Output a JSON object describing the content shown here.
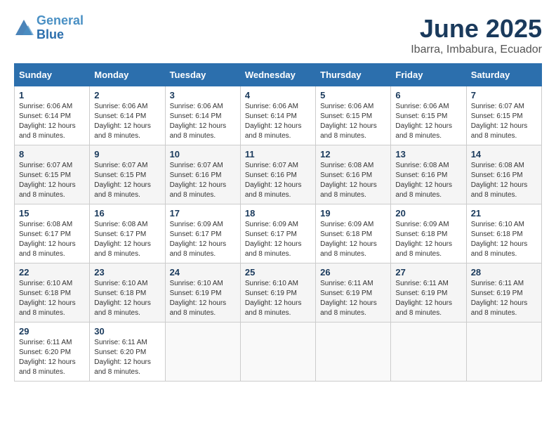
{
  "header": {
    "logo_line1": "General",
    "logo_line2": "Blue",
    "month": "June 2025",
    "location": "Ibarra, Imbabura, Ecuador"
  },
  "days_of_week": [
    "Sunday",
    "Monday",
    "Tuesday",
    "Wednesday",
    "Thursday",
    "Friday",
    "Saturday"
  ],
  "weeks": [
    [
      {
        "day": "1",
        "sunrise": "6:06 AM",
        "sunset": "6:14 PM",
        "daylight": "12 hours and 8 minutes."
      },
      {
        "day": "2",
        "sunrise": "6:06 AM",
        "sunset": "6:14 PM",
        "daylight": "12 hours and 8 minutes."
      },
      {
        "day": "3",
        "sunrise": "6:06 AM",
        "sunset": "6:14 PM",
        "daylight": "12 hours and 8 minutes."
      },
      {
        "day": "4",
        "sunrise": "6:06 AM",
        "sunset": "6:14 PM",
        "daylight": "12 hours and 8 minutes."
      },
      {
        "day": "5",
        "sunrise": "6:06 AM",
        "sunset": "6:15 PM",
        "daylight": "12 hours and 8 minutes."
      },
      {
        "day": "6",
        "sunrise": "6:06 AM",
        "sunset": "6:15 PM",
        "daylight": "12 hours and 8 minutes."
      },
      {
        "day": "7",
        "sunrise": "6:07 AM",
        "sunset": "6:15 PM",
        "daylight": "12 hours and 8 minutes."
      }
    ],
    [
      {
        "day": "8",
        "sunrise": "6:07 AM",
        "sunset": "6:15 PM",
        "daylight": "12 hours and 8 minutes."
      },
      {
        "day": "9",
        "sunrise": "6:07 AM",
        "sunset": "6:15 PM",
        "daylight": "12 hours and 8 minutes."
      },
      {
        "day": "10",
        "sunrise": "6:07 AM",
        "sunset": "6:16 PM",
        "daylight": "12 hours and 8 minutes."
      },
      {
        "day": "11",
        "sunrise": "6:07 AM",
        "sunset": "6:16 PM",
        "daylight": "12 hours and 8 minutes."
      },
      {
        "day": "12",
        "sunrise": "6:08 AM",
        "sunset": "6:16 PM",
        "daylight": "12 hours and 8 minutes."
      },
      {
        "day": "13",
        "sunrise": "6:08 AM",
        "sunset": "6:16 PM",
        "daylight": "12 hours and 8 minutes."
      },
      {
        "day": "14",
        "sunrise": "6:08 AM",
        "sunset": "6:16 PM",
        "daylight": "12 hours and 8 minutes."
      }
    ],
    [
      {
        "day": "15",
        "sunrise": "6:08 AM",
        "sunset": "6:17 PM",
        "daylight": "12 hours and 8 minutes."
      },
      {
        "day": "16",
        "sunrise": "6:08 AM",
        "sunset": "6:17 PM",
        "daylight": "12 hours and 8 minutes."
      },
      {
        "day": "17",
        "sunrise": "6:09 AM",
        "sunset": "6:17 PM",
        "daylight": "12 hours and 8 minutes."
      },
      {
        "day": "18",
        "sunrise": "6:09 AM",
        "sunset": "6:17 PM",
        "daylight": "12 hours and 8 minutes."
      },
      {
        "day": "19",
        "sunrise": "6:09 AM",
        "sunset": "6:18 PM",
        "daylight": "12 hours and 8 minutes."
      },
      {
        "day": "20",
        "sunrise": "6:09 AM",
        "sunset": "6:18 PM",
        "daylight": "12 hours and 8 minutes."
      },
      {
        "day": "21",
        "sunrise": "6:10 AM",
        "sunset": "6:18 PM",
        "daylight": "12 hours and 8 minutes."
      }
    ],
    [
      {
        "day": "22",
        "sunrise": "6:10 AM",
        "sunset": "6:18 PM",
        "daylight": "12 hours and 8 minutes."
      },
      {
        "day": "23",
        "sunrise": "6:10 AM",
        "sunset": "6:18 PM",
        "daylight": "12 hours and 8 minutes."
      },
      {
        "day": "24",
        "sunrise": "6:10 AM",
        "sunset": "6:19 PM",
        "daylight": "12 hours and 8 minutes."
      },
      {
        "day": "25",
        "sunrise": "6:10 AM",
        "sunset": "6:19 PM",
        "daylight": "12 hours and 8 minutes."
      },
      {
        "day": "26",
        "sunrise": "6:11 AM",
        "sunset": "6:19 PM",
        "daylight": "12 hours and 8 minutes."
      },
      {
        "day": "27",
        "sunrise": "6:11 AM",
        "sunset": "6:19 PM",
        "daylight": "12 hours and 8 minutes."
      },
      {
        "day": "28",
        "sunrise": "6:11 AM",
        "sunset": "6:19 PM",
        "daylight": "12 hours and 8 minutes."
      }
    ],
    [
      {
        "day": "29",
        "sunrise": "6:11 AM",
        "sunset": "6:20 PM",
        "daylight": "12 hours and 8 minutes."
      },
      {
        "day": "30",
        "sunrise": "6:11 AM",
        "sunset": "6:20 PM",
        "daylight": "12 hours and 8 minutes."
      },
      null,
      null,
      null,
      null,
      null
    ]
  ],
  "labels": {
    "sunrise": "Sunrise:",
    "sunset": "Sunset:",
    "daylight": "Daylight:"
  }
}
